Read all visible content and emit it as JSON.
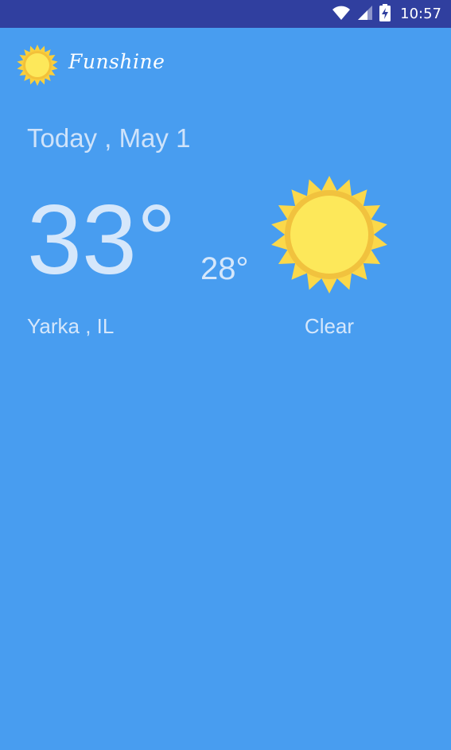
{
  "status_bar": {
    "time": "10:57",
    "icons": [
      "wifi-icon",
      "cellular-signal-icon",
      "battery-charging-icon"
    ],
    "background_color": "#303f9f"
  },
  "app_bar": {
    "title": "Funshine",
    "logo_icon": "sun-icon"
  },
  "forecast": {
    "date": "Today , May 1",
    "high_temp": "33°",
    "low_temp": "28°",
    "location": "Yarka , IL",
    "condition": "Clear",
    "condition_icon": "sun-icon"
  },
  "colors": {
    "background": "#489df0",
    "text": "#d5e7fb",
    "sun_outer": "#f9cf3d",
    "sun_inner": "#fde85a"
  }
}
